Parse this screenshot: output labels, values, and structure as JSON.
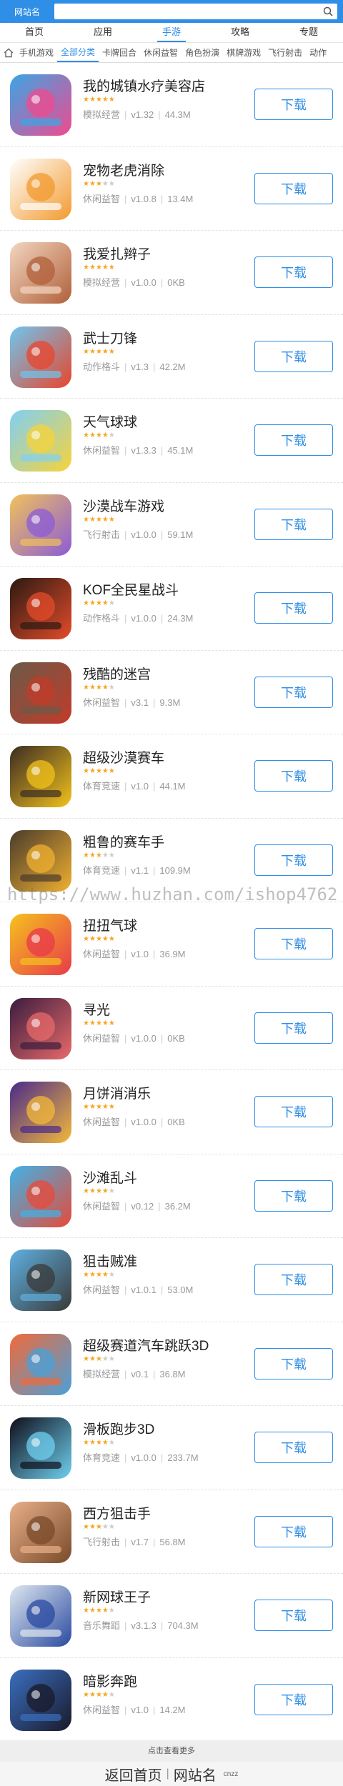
{
  "header": {
    "site_name": "网站名",
    "search_placeholder": ""
  },
  "mainnav": [
    "首页",
    "应用",
    "手游",
    "攻略",
    "专题"
  ],
  "subnav": [
    "手机游戏",
    "全部分类",
    "卡牌回合",
    "休闲益智",
    "角色扮演",
    "棋牌游戏",
    "飞行射击",
    "动作"
  ],
  "download_label": "下载",
  "apps": [
    {
      "name": "我的城镇水疗美容店",
      "rating": 5,
      "category": "模拟经营",
      "version": "v1.32",
      "size": "44.3M",
      "icon": "spa-town-icon",
      "c1": "#39a6e6",
      "c2": "#f04a8f"
    },
    {
      "name": "宠物老虎消除",
      "rating": 3,
      "category": "休闲益智",
      "version": "v1.0.8",
      "size": "13.4M",
      "icon": "pet-tiger-icon",
      "c1": "#ffffff",
      "c2": "#f29a2e"
    },
    {
      "name": "我爱扎辫子",
      "rating": 5,
      "category": "模拟经营",
      "version": "v1.0.0",
      "size": "0KB",
      "icon": "braid-icon",
      "c1": "#f3d6c0",
      "c2": "#b0603a"
    },
    {
      "name": "武士刀锋",
      "rating": 5,
      "category": "动作格斗",
      "version": "v1.3",
      "size": "42.2M",
      "icon": "samurai-icon",
      "c1": "#6ec6ef",
      "c2": "#e8452c"
    },
    {
      "name": "天气球球",
      "rating": 4,
      "category": "休闲益智",
      "version": "v1.3.3",
      "size": "45.1M",
      "icon": "weather-ball-icon",
      "c1": "#7fd0f5",
      "c2": "#f7d33a"
    },
    {
      "name": "沙漠战车游戏",
      "rating": 5,
      "category": "飞行射击",
      "version": "v1.0.0",
      "size": "59.1M",
      "icon": "desert-car-icon",
      "c1": "#f1c15b",
      "c2": "#8b5cd6"
    },
    {
      "name": "KOF全民星战斗",
      "rating": 4,
      "category": "动作格斗",
      "version": "v1.0.0",
      "size": "24.3M",
      "icon": "kof-icon",
      "c1": "#2a1a12",
      "c2": "#e44b2a"
    },
    {
      "name": "残酷的迷宫",
      "rating": 4,
      "category": "休闲益智",
      "version": "v3.1",
      "size": "9.3M",
      "icon": "maze-icon",
      "c1": "#6b5a48",
      "c2": "#c23b2a"
    },
    {
      "name": "超级沙漠赛车",
      "rating": 5,
      "category": "体育竞速",
      "version": "v1.0",
      "size": "44.1M",
      "icon": "desert-racing-icon",
      "c1": "#3b2b24",
      "c2": "#f2c21b"
    },
    {
      "name": "粗鲁的赛车手",
      "rating": 3,
      "category": "体育竞速",
      "version": "v1.1",
      "size": "109.9M",
      "icon": "rude-racer-icon",
      "c1": "#4a3b2c",
      "c2": "#f0b030"
    },
    {
      "name": "扭扭气球",
      "rating": 5,
      "category": "休闲益智",
      "version": "v1.0",
      "size": "36.9M",
      "icon": "balloon-dog-icon",
      "c1": "#f6c21e",
      "c2": "#e83a4a"
    },
    {
      "name": "寻光",
      "rating": 5,
      "category": "休闲益智",
      "version": "v1.0.0",
      "size": "0KB",
      "icon": "seek-light-icon",
      "c1": "#3a1c3f",
      "c2": "#e86a6a"
    },
    {
      "name": "月饼消消乐",
      "rating": 5,
      "category": "休闲益智",
      "version": "v1.0.0",
      "size": "0KB",
      "icon": "mooncake-icon",
      "c1": "#4a2a8a",
      "c2": "#f3b83a"
    },
    {
      "name": "沙滩乱斗",
      "rating": 4,
      "category": "休闲益智",
      "version": "v0.12",
      "size": "36.2M",
      "icon": "beach-brawl-icon",
      "c1": "#3db4e8",
      "c2": "#e84a3a"
    },
    {
      "name": "狙击贼准",
      "rating": 4,
      "category": "休闲益智",
      "version": "v1.0.1",
      "size": "53.0M",
      "icon": "sniper-icon",
      "c1": "#5fb0e0",
      "c2": "#3a3a3a"
    },
    {
      "name": "超级赛道汽车跳跃3D",
      "rating": 3,
      "category": "模拟经营",
      "version": "v0.1",
      "size": "36.8M",
      "icon": "car-jump-icon",
      "c1": "#f06a3a",
      "c2": "#4aa0d8"
    },
    {
      "name": "滑板跑步3D",
      "rating": 4,
      "category": "体育竞速",
      "version": "v1.0.0",
      "size": "233.7M",
      "icon": "skateboard-icon",
      "c1": "#0e0e1a",
      "c2": "#6fd0f0"
    },
    {
      "name": "西方狙击手",
      "rating": 3,
      "category": "飞行射击",
      "version": "v1.7",
      "size": "56.8M",
      "icon": "western-sniper-icon",
      "c1": "#e8b08a",
      "c2": "#7a4a2a"
    },
    {
      "name": "新网球王子",
      "rating": 4,
      "category": "音乐舞蹈",
      "version": "v3.1.3",
      "size": "704.3M",
      "icon": "tennis-prince-icon",
      "c1": "#dfe8f0",
      "c2": "#2a4aa0"
    },
    {
      "name": "暗影奔跑",
      "rating": 4,
      "category": "休闲益智",
      "version": "v1.0",
      "size": "14.2M",
      "icon": "shadow-run-icon",
      "c1": "#3a6fc0",
      "c2": "#1a1a2a"
    }
  ],
  "watermark": "https://www.huzhan.com/ishop4762",
  "more_label": "点击查看更多",
  "footer": {
    "back_home": "返回首页",
    "site_name": "网站名",
    "cnzz": "cnzz"
  }
}
